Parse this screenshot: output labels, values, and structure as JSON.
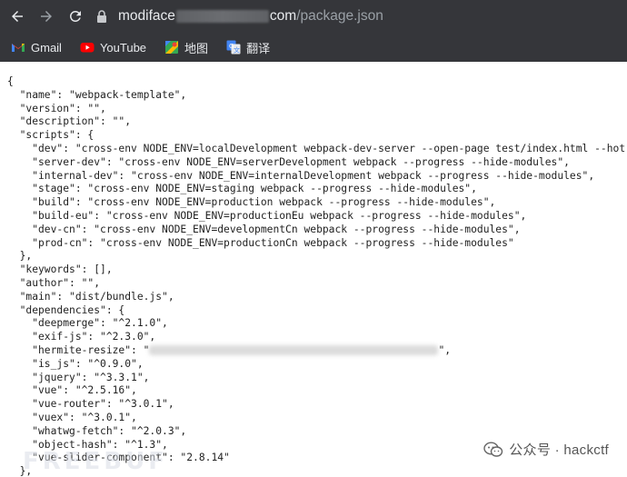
{
  "browser": {
    "url": {
      "host_start": "modiface",
      "host_end": "com",
      "path": "/package.json"
    },
    "bookmarks": [
      {
        "label": "Gmail",
        "icon": "gmail-icon"
      },
      {
        "label": "YouTube",
        "icon": "youtube-icon"
      },
      {
        "label": "地图",
        "icon": "maps-icon"
      },
      {
        "label": "翻译",
        "icon": "translate-icon"
      }
    ]
  },
  "json_lines": [
    "{",
    "  \"name\": \"webpack-template\",",
    "  \"version\": \"\",",
    "  \"description\": \"\",",
    "  \"scripts\": {",
    "    \"dev\": \"cross-env NODE_ENV=localDevelopment webpack-dev-server --open-page test/index.html --hot\",",
    "    \"server-dev\": \"cross-env NODE_ENV=serverDevelopment webpack --progress --hide-modules\",",
    "    \"internal-dev\": \"cross-env NODE_ENV=internalDevelopment webpack --progress --hide-modules\",",
    "    \"stage\": \"cross-env NODE_ENV=staging webpack --progress --hide-modules\",",
    "    \"build\": \"cross-env NODE_ENV=production webpack --progress --hide-modules\",",
    "    \"build-eu\": \"cross-env NODE_ENV=productionEu webpack --progress --hide-modules\",",
    "    \"dev-cn\": \"cross-env NODE_ENV=developmentCn webpack --progress --hide-modules\",",
    "    \"prod-cn\": \"cross-env NODE_ENV=productionCn webpack --progress --hide-modules\"",
    "  },",
    "  \"keywords\": [],",
    "  \"author\": \"\",",
    "  \"main\": \"dist/bundle.js\",",
    "  \"dependencies\": {",
    "    \"deepmerge\": \"^2.1.0\",",
    "    \"exif-js\": \"^2.3.0\",",
    "    \"hermite-resize\": \"",
    "    \"is_js\": \"^0.9.0\",",
    "    \"jquery\": \"^3.3.1\",",
    "    \"vue\": \"^2.5.16\",",
    "    \"vue-router\": \"^3.0.1\",",
    "    \"vuex\": \"^3.0.1\",",
    "    \"whatwg-fetch\": \"^2.0.3\",",
    "    \"object-hash\": \"^1.3\",",
    "    \"vue-slider-component\": \"2.8.14\"",
    "  },"
  ],
  "hermite_tail": "\",",
  "watermark": {
    "text": "公众号 · hackctf",
    "icon": "wechat-icon"
  },
  "colors": {
    "chrome_bg": "#35363a",
    "chrome_text": "#e8eaed",
    "page_bg": "#ffffff"
  }
}
